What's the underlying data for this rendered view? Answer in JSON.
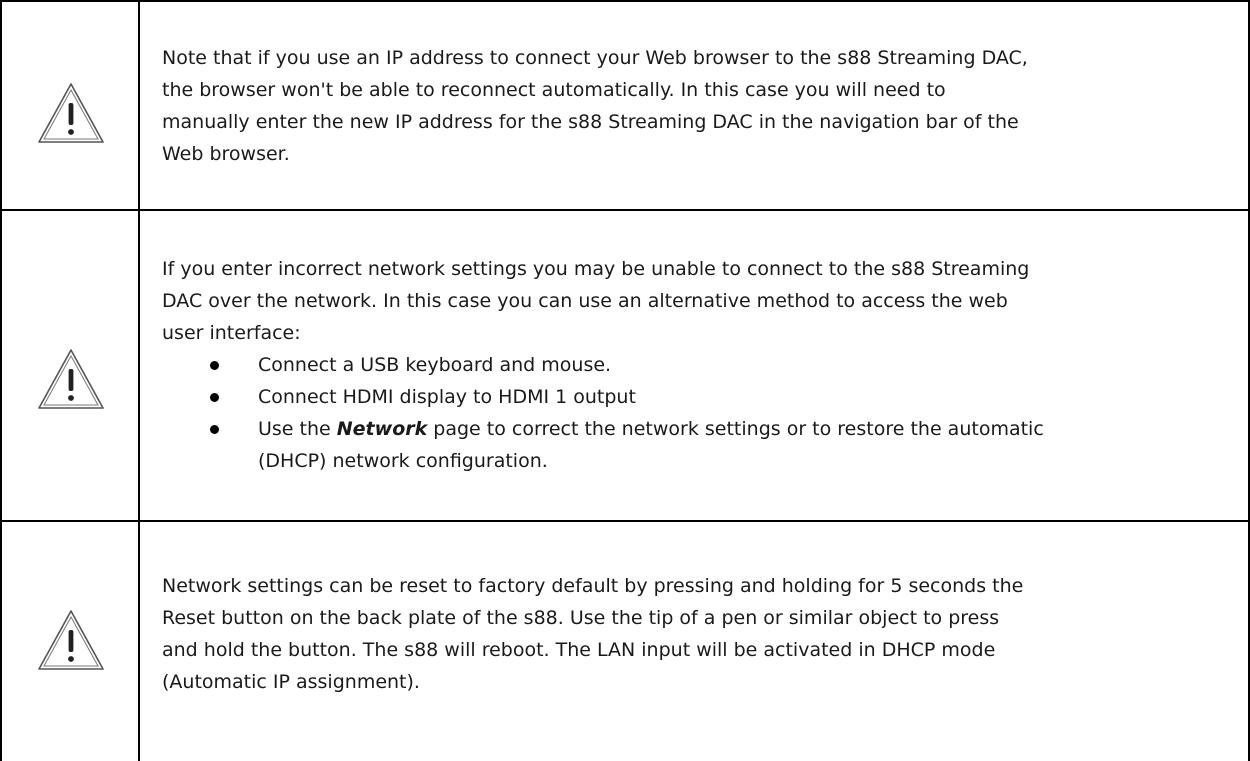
{
  "notes": [
    {
      "icon": "warning-triangle-icon",
      "lines": [
        "Note that if you use an IP address to connect your Web browser to the s88 Streaming DAC,",
        "the browser won't be able to reconnect automatically. In this case you will need to",
        "manually enter the new IP address for the s88 Streaming DAC in the navigation bar of the",
        "Web browser."
      ]
    },
    {
      "icon": "warning-triangle-icon",
      "lines": [
        "If you enter incorrect network settings you may be unable to connect to the s88 Streaming",
        "DAC over the network.  In this case you can use an alternative method to access the web",
        "user interface:"
      ],
      "bullets": [
        "Connect a USB keyboard and mouse.",
        "Connect HDMI display to HDMI 1 output"
      ],
      "bullet3": {
        "prefix": "Use the ",
        "emphasis": "Network",
        "suffix": " page to correct the network settings or to restore the automatic",
        "continuation": "(DHCP) network configuration."
      }
    },
    {
      "icon": "warning-triangle-icon",
      "lines": [
        "Network settings can be reset to factory default by pressing and holding for 5 seconds the",
        "Reset button on the back plate of the s88. Use the tip of a pen or similar object to press",
        "and hold the button. The s88 will reboot. The LAN input will be activated in DHCP mode",
        "(Automatic IP assignment)."
      ]
    }
  ]
}
